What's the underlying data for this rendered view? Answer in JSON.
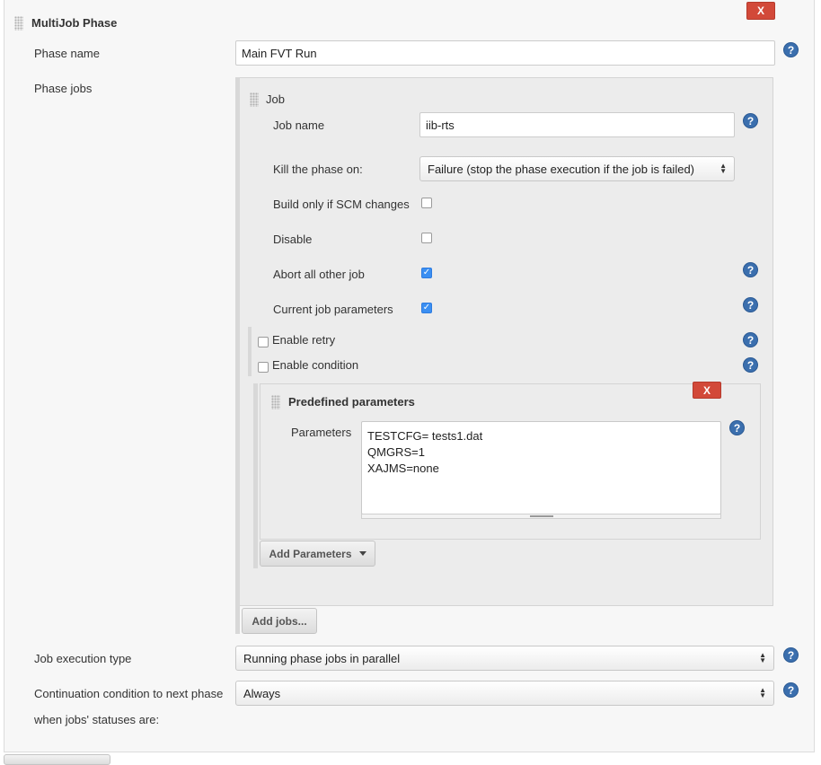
{
  "phase": {
    "title": "MultiJob Phase",
    "delete_label": "X",
    "name_label": "Phase name",
    "name_value": "Main FVT Run",
    "jobs_label": "Phase jobs"
  },
  "job": {
    "title": "Job",
    "job_name_label": "Job name",
    "job_name_value": "iib-rts",
    "kill_label": "Kill the phase on:",
    "kill_value": "Failure (stop the phase execution if the job is failed)",
    "build_scm_label": "Build only if SCM changes",
    "build_scm_checked": false,
    "disable_label": "Disable",
    "disable_checked": false,
    "abort_label": "Abort all other job",
    "abort_checked": true,
    "current_params_label": "Current job parameters",
    "current_params_checked": true,
    "enable_retry_label": "Enable retry",
    "enable_condition_label": "Enable condition"
  },
  "predefined": {
    "title": "Predefined parameters",
    "delete_label": "X",
    "params_label": "Parameters",
    "params_value": "TESTCFG= tests1.dat\nQMGRS=1\nXAJMS=none",
    "add_params_label": "Add Parameters"
  },
  "add_jobs_label": "Add jobs...",
  "execution": {
    "label": "Job execution type",
    "value": "Running phase jobs in parallel"
  },
  "continuation": {
    "label_line1": "Continuation condition to next phase",
    "label_line2": "when jobs' statuses are:",
    "value": "Always"
  },
  "icons": {
    "help": "help-icon",
    "drag": "drag-handle-icon",
    "check": "checkmark-icon",
    "dropdown": "dropdown-arrow-icon"
  },
  "colors": {
    "delete_red": "#d24939",
    "help_blue": "#3b6fae",
    "checkbox_blue": "#3b8ff2"
  }
}
